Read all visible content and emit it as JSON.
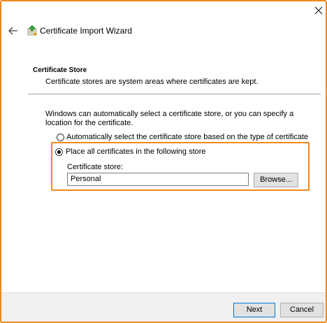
{
  "window": {
    "title": "Certificate Import Wizard",
    "accent_color": "#f0891c"
  },
  "section": {
    "title": "Certificate Store",
    "description": "Certificate stores are system areas where certificates are kept."
  },
  "intro": "Windows can automatically select a certificate store, or you can specify a location for the certificate.",
  "options": {
    "auto_label": "Automatically select the certificate store based on the type of certificate",
    "place_label": "Place all certificates in the following store",
    "selected": "place"
  },
  "store": {
    "label": "Certificate store:",
    "value": "Personal",
    "browse_label": "Browse..."
  },
  "footer": {
    "next_label": "Next",
    "cancel_label": "Cancel"
  }
}
